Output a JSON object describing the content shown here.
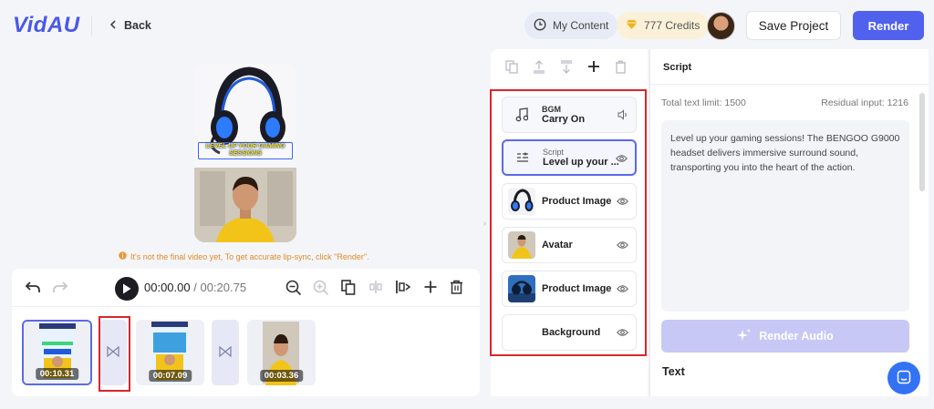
{
  "header": {
    "logo": "VidAU",
    "back_label": "Back",
    "my_content_label": "My Content",
    "credits_label": "777 Credits",
    "save_label": "Save Project",
    "render_label": "Render"
  },
  "preview": {
    "caption_line1": "LEVEL UP YOUR GAMING",
    "caption_line2": "SESSIONS",
    "warning": "It's not the final video yet, To get accurate lip-sync, click \"Render\"."
  },
  "timeline": {
    "current_time": "00:00.00",
    "separator": "/",
    "total_time": "00:20.75",
    "clips": [
      {
        "duration": "00:10.31"
      },
      {
        "duration": "00:07.09"
      },
      {
        "duration": "00:03.36"
      }
    ]
  },
  "layers": [
    {
      "label_small": "BGM",
      "label": "Carry On",
      "icon": "music-note-icon",
      "action_icon": "volume-icon"
    },
    {
      "label_small": "Script",
      "label": "Level up your ...",
      "icon": "script-text-icon",
      "action_icon": "eye-icon"
    },
    {
      "label": "Product Image",
      "icon": "headset-thumbnail",
      "action_icon": "eye-icon"
    },
    {
      "label": "Avatar",
      "icon": "avatar-thumbnail",
      "action_icon": "eye-icon"
    },
    {
      "label": "Product Image",
      "icon": "headset-blue-thumbnail",
      "action_icon": "eye-icon"
    },
    {
      "label": "Background",
      "icon": "none",
      "action_icon": "eye-icon"
    }
  ],
  "script": {
    "title": "Script",
    "total_limit": "Total text limit: 1500",
    "residual": "Residual input: 1216",
    "text": "Level up your gaming sessions! The BENGOO G9000 headset delivers immersive surround sound, transporting you into the heart of the action.",
    "render_audio_label": "Render Audio",
    "text_section_title": "Text"
  },
  "colors": {
    "accent": "#5061ee",
    "highlight_box": "#d8262c",
    "warning": "#e08a2a"
  }
}
